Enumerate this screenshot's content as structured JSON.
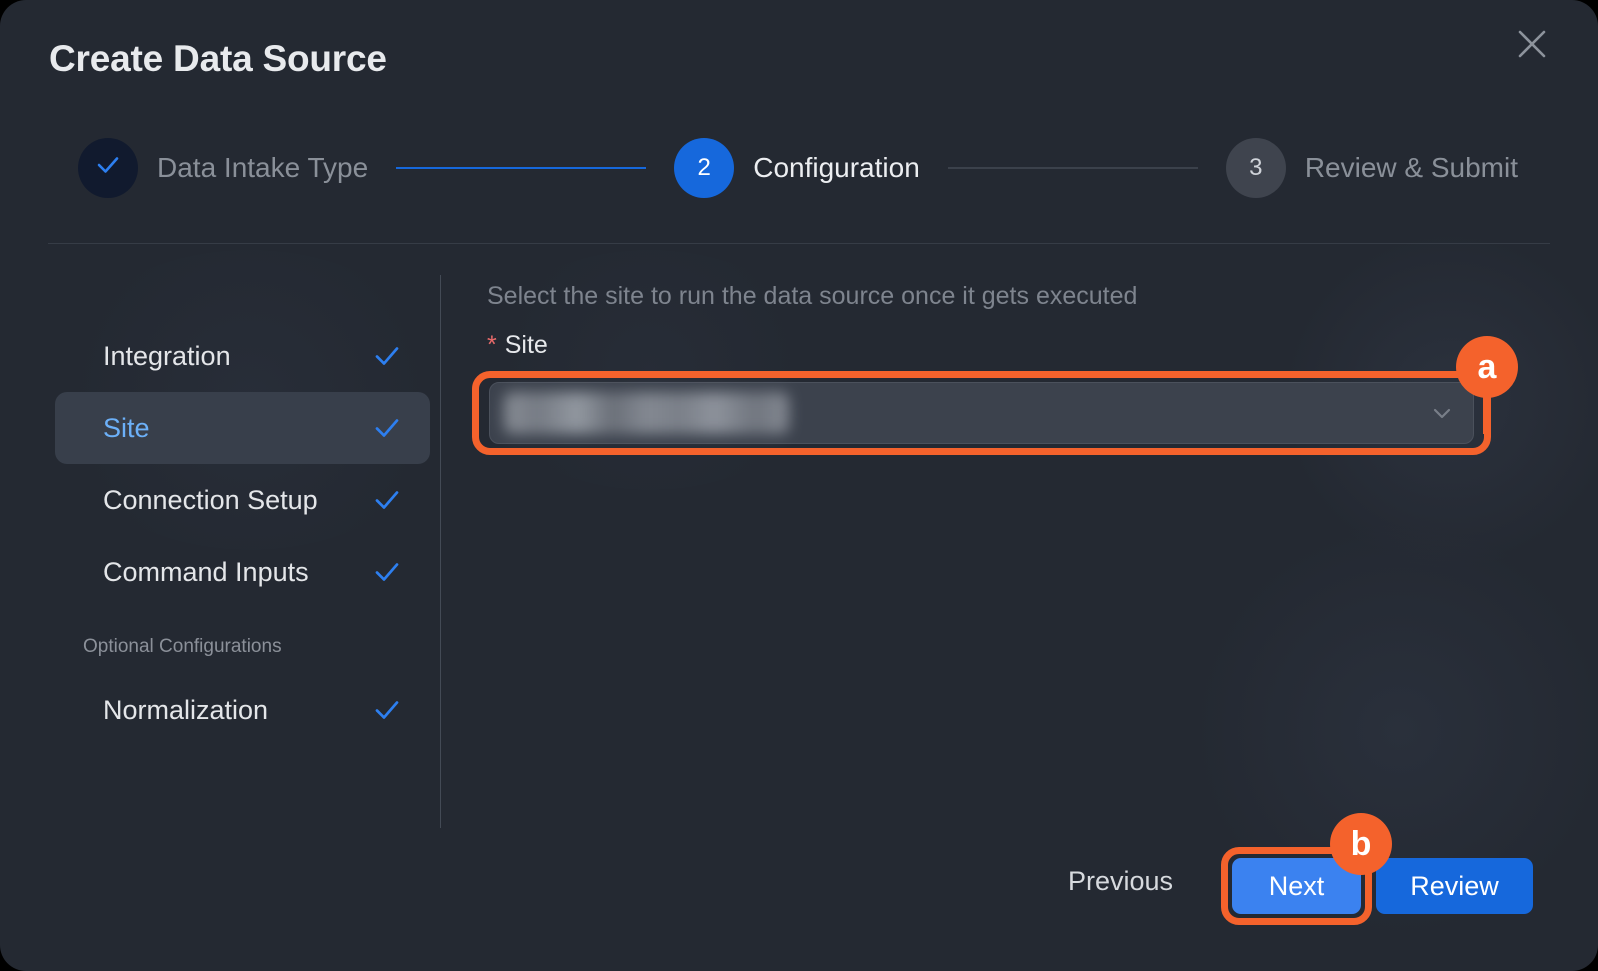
{
  "modal": {
    "title": "Create Data Source",
    "close_icon": "close-icon"
  },
  "stepper": {
    "steps": [
      {
        "index": "1",
        "marker": "check-icon",
        "label": "Data Intake Type",
        "state": "done"
      },
      {
        "index": "2",
        "marker": "2",
        "label": "Configuration",
        "state": "active"
      },
      {
        "index": "3",
        "marker": "3",
        "label": "Review & Submit",
        "state": "todo"
      }
    ]
  },
  "sidebar": {
    "items": [
      {
        "label": "Integration",
        "checked": true,
        "selected": false
      },
      {
        "label": "Site",
        "checked": true,
        "selected": true
      },
      {
        "label": "Connection Setup",
        "checked": true,
        "selected": false
      },
      {
        "label": "Command Inputs",
        "checked": true,
        "selected": false
      }
    ],
    "optional_section_title": "Optional Configurations",
    "optional_items": [
      {
        "label": "Normalization",
        "checked": true,
        "selected": false
      }
    ]
  },
  "panel": {
    "description": "Select the site to run the data source once it gets executed",
    "field_label": "Site",
    "required_marker": "*",
    "select_value": "",
    "select_value_redacted": true,
    "chevron_icon": "chevron-down-icon"
  },
  "footer": {
    "previous_label": "Previous",
    "next_label": "Next",
    "review_label": "Review"
  },
  "annotations": [
    {
      "id": "a",
      "target": "site-select"
    },
    {
      "id": "b",
      "target": "next-button"
    }
  ],
  "colors": {
    "accent_blue": "#1668dc",
    "annotation_orange": "#f4622c",
    "modal_bg": "#242932",
    "selected_item_bg": "#383f4b",
    "selected_item_text": "#6cb0f8",
    "required_star": "#e86a6a"
  }
}
